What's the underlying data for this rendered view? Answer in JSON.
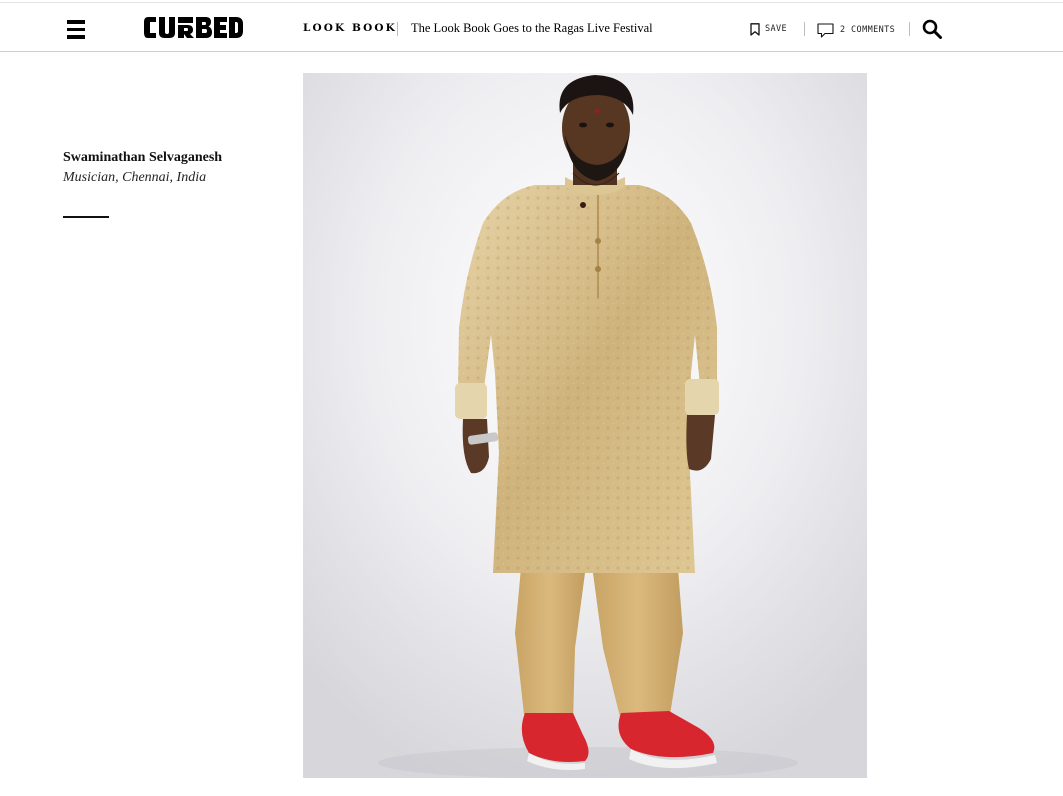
{
  "header": {
    "brand": "CURBED",
    "section": "LOOK BOOK",
    "headline": "The Look Book Goes to the Ragas Live Festival",
    "save_label": "SAVE",
    "comments_label": "2 COMMENTS",
    "icons": [
      "menu-icon",
      "bookmark-icon",
      "comment-icon",
      "search-icon"
    ]
  },
  "caption": {
    "name": "Swaminathan Selvaganesh",
    "description": "Musician, Chennai, India"
  },
  "colors": {
    "kurta": "#d8c08e",
    "pants": "#cfa96c",
    "sneakers": "#d8262f",
    "background": "#ffffff"
  }
}
